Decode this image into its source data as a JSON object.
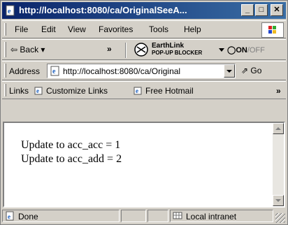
{
  "window": {
    "title": "http://localhost:8080/ca/OriginalSeeA...",
    "min_label": "_",
    "max_label": "□",
    "close_label": "✕"
  },
  "menu": {
    "items": [
      "File",
      "Edit",
      "View",
      "Favorites",
      "Tools",
      "Help"
    ]
  },
  "toolbar": {
    "back_label": "⇦ Back ▾",
    "overflow_label": "»",
    "earthlink_line1": "EarthLink",
    "earthlink_line2": "POP-UP BLOCKER",
    "popup_on": "ON",
    "popup_off": "/OFF"
  },
  "address": {
    "label": "Address",
    "value": "http://localhost:8080/ca/Original",
    "go_label": "Go"
  },
  "links": {
    "label": "Links",
    "items": [
      "Customize Links",
      "Free Hotmail"
    ],
    "overflow_label": "»"
  },
  "content": {
    "lines": [
      "Update to acc_acc = 1",
      "Update to acc_add = 2"
    ]
  },
  "status": {
    "text": "Done",
    "zone": "Local intranet"
  },
  "colors": {
    "titlebar_start": "#0a246a",
    "titlebar_end": "#3a6ea5",
    "chrome": "#d4d0c8"
  }
}
